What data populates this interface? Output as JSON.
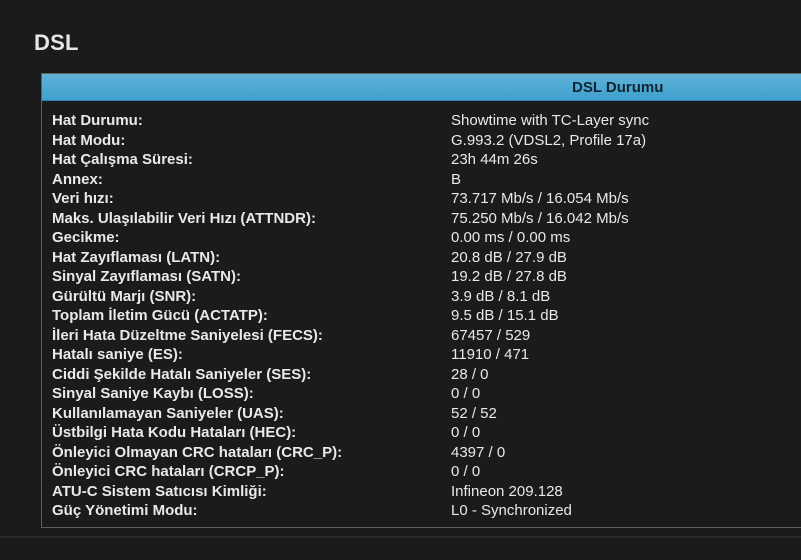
{
  "page": {
    "title": "DSL"
  },
  "panel": {
    "header": "DSL Durumu",
    "rows": [
      {
        "label": "Hat Durumu:",
        "value": "Showtime with TC-Layer sync"
      },
      {
        "label": "Hat Modu:",
        "value": "G.993.2 (VDSL2, Profile 17a)"
      },
      {
        "label": "Hat Çalışma Süresi:",
        "value": "23h 44m 26s"
      },
      {
        "label": "Annex:",
        "value": "B"
      },
      {
        "label": "Veri hızı:",
        "value": "73.717 Mb/s / 16.054 Mb/s"
      },
      {
        "label": "Maks. Ulaşılabilir Veri Hızı (ATTNDR):",
        "value": "75.250 Mb/s / 16.042 Mb/s"
      },
      {
        "label": "Gecikme:",
        "value": "0.00 ms / 0.00 ms"
      },
      {
        "label": "Hat Zayıflaması (LATN):",
        "value": "20.8 dB / 27.9 dB"
      },
      {
        "label": "Sinyal Zayıflaması (SATN):",
        "value": "19.2 dB / 27.8 dB"
      },
      {
        "label": "Gürültü Marjı (SNR):",
        "value": "3.9 dB / 8.1 dB"
      },
      {
        "label": "Toplam İletim Gücü (ACTATP):",
        "value": "9.5 dB / 15.1 dB"
      },
      {
        "label": "İleri Hata Düzeltme Saniyelesi (FECS):",
        "value": "67457 / 529"
      },
      {
        "label": "Hatalı saniye (ES):",
        "value": "11910 / 471"
      },
      {
        "label": "Ciddi Şekilde Hatalı Saniyeler (SES):",
        "value": "28 / 0"
      },
      {
        "label": "Sinyal Saniye Kaybı (LOSS):",
        "value": "0 / 0"
      },
      {
        "label": "Kullanılamayan Saniyeler (UAS):",
        "value": "52 / 52"
      },
      {
        "label": "Üstbilgi Hata Kodu Hataları (HEC):",
        "value": "0 / 0"
      },
      {
        "label": "Önleyici Olmayan CRC hataları (CRC_P):",
        "value": "4397 / 0"
      },
      {
        "label": "Önleyici CRC hataları (CRCP_P):",
        "value": "0 / 0"
      },
      {
        "label": "ATU-C Sistem Satıcısı Kimliği:",
        "value": "Infineon 209.128"
      },
      {
        "label": "Güç Yönetimi Modu:",
        "value": "L0 - Synchronized"
      }
    ]
  },
  "colors": {
    "background": "#1b1b1b",
    "header_blue": "#4aa7d1",
    "text": "#e9e9e9"
  }
}
